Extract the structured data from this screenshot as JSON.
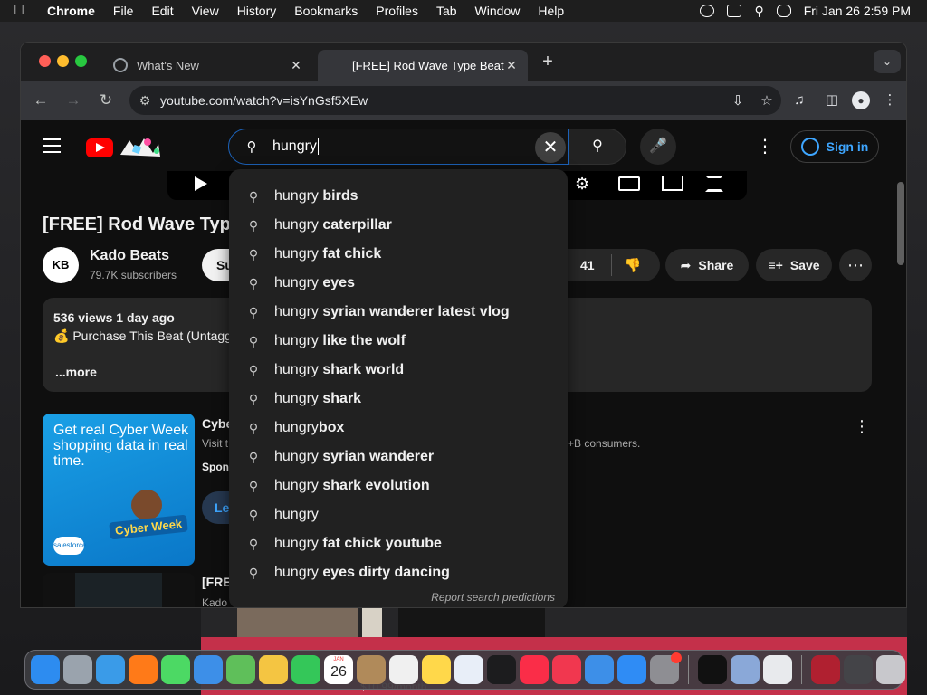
{
  "menubar": {
    "app_name": "Chrome",
    "items": [
      "File",
      "Edit",
      "View",
      "History",
      "Bookmarks",
      "Profiles",
      "Tab",
      "Window",
      "Help"
    ],
    "datetime": "Fri Jan 26  2:59 PM"
  },
  "browser": {
    "tabs": [
      {
        "title": "What's New",
        "active": false
      },
      {
        "title": "[FREE] Rod Wave Type Beat x",
        "active": true
      }
    ],
    "url": "youtube.com/watch?v=isYnGsf5XEw"
  },
  "youtube": {
    "search_query": "hungry",
    "signin_label": "Sign in",
    "video_title": "[FREE] Rod Wave Type",
    "channel": {
      "avatar_text": "KB",
      "name": "Kado Beats",
      "subscribers": "79.7K subscribers",
      "subscribe_label": "Su"
    },
    "actions": {
      "like_count": "41",
      "share_label": "Share",
      "save_label": "Save"
    },
    "description": {
      "meta": "536 views  1 day ago",
      "line1": "💰 Purchase This Beat (Untagg",
      "more": "...more"
    },
    "ad": {
      "headline": "Get real Cyber Week shopping data in real time.",
      "badge": "Cyber Week",
      "brand": "salesforce",
      "title": "Cybe",
      "visit": "Visit t",
      "right_text": "+B consumers.",
      "sponsored": "Spon",
      "learn": "Le"
    },
    "related": {
      "title": "[FRE",
      "channel": "Kado"
    },
    "suggestions": [
      {
        "prefix": "hungry ",
        "bold": "birds"
      },
      {
        "prefix": "hungry ",
        "bold": "caterpillar"
      },
      {
        "prefix": "hungry ",
        "bold": "fat chick"
      },
      {
        "prefix": "hungry ",
        "bold": "eyes"
      },
      {
        "prefix": "hungry ",
        "bold": "syrian wanderer latest vlog"
      },
      {
        "prefix": "hungry ",
        "bold": "like the wolf"
      },
      {
        "prefix": "hungry ",
        "bold": "shark world"
      },
      {
        "prefix": "hungry ",
        "bold": "shark"
      },
      {
        "prefix": "hungry",
        "bold": "box"
      },
      {
        "prefix": "hungry ",
        "bold": "syrian wanderer"
      },
      {
        "prefix": "hungry ",
        "bold": "shark evolution"
      },
      {
        "prefix": "hungry",
        "bold": ""
      },
      {
        "prefix": "hungry ",
        "bold": "fat chick youtube"
      },
      {
        "prefix": "hungry ",
        "bold": "eyes dirty dancing"
      }
    ],
    "report_label": "Report search predictions"
  },
  "dock": {
    "calendar_month": "JAN",
    "calendar_day": "26",
    "apps": [
      {
        "name": "finder",
        "color": "#2d8cf0"
      },
      {
        "name": "launchpad",
        "color": "#9aa3ad"
      },
      {
        "name": "safari",
        "color": "#3a9be8"
      },
      {
        "name": "firefox",
        "color": "#ff7a18"
      },
      {
        "name": "messages",
        "color": "#4cd964"
      },
      {
        "name": "mail",
        "color": "#3d8fe8"
      },
      {
        "name": "maps",
        "color": "#5fbf5a"
      },
      {
        "name": "photos",
        "color": "#f4c542"
      },
      {
        "name": "facetime",
        "color": "#34c759"
      },
      {
        "name": "calendar",
        "color": "#ffffff"
      },
      {
        "name": "contacts",
        "color": "#b08a5a"
      },
      {
        "name": "reminders",
        "color": "#f0f0f0"
      },
      {
        "name": "notes",
        "color": "#ffd84a"
      },
      {
        "name": "freeform",
        "color": "#e8eef8"
      },
      {
        "name": "apple-tv",
        "color": "#1c1c1e"
      },
      {
        "name": "music",
        "color": "#fa2d48"
      },
      {
        "name": "news",
        "color": "#f1374f"
      },
      {
        "name": "keynote",
        "color": "#3d8fe8"
      },
      {
        "name": "app-store",
        "color": "#2f8cf5"
      },
      {
        "name": "system-settings",
        "color": "#8e8e93"
      },
      {
        "name": "terminal",
        "color": "#111111"
      },
      {
        "name": "virtualbox",
        "color": "#8aa8d8"
      },
      {
        "name": "chrome",
        "color": "#e8eaed"
      },
      {
        "name": "wine",
        "color": "#b02030"
      },
      {
        "name": "screenshot",
        "color": "#444448"
      },
      {
        "name": "trash",
        "color": "#c8c8cc"
      }
    ]
  },
  "desktop": {
    "price_fragment": "$10.99/month."
  }
}
